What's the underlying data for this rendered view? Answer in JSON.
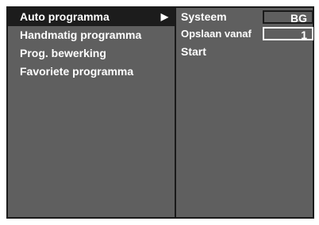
{
  "menu": {
    "items": [
      {
        "label": "Auto programma",
        "selected": true,
        "arrow": "▶"
      },
      {
        "label": "Handmatig programma",
        "selected": false
      },
      {
        "label": "Prog. bewerking",
        "selected": false
      },
      {
        "label": "Favoriete programma",
        "selected": false
      }
    ]
  },
  "submenu": {
    "system_label": "Systeem",
    "system_value": "BG",
    "store_from_label": "Opslaan vanaf",
    "store_from_value": "1",
    "start_label": "Start"
  },
  "colors": {
    "panel_bg": "#5f5f5f",
    "selected_bg": "#1c1c1c",
    "text": "#ffffff",
    "border": "#1a1a1a"
  }
}
